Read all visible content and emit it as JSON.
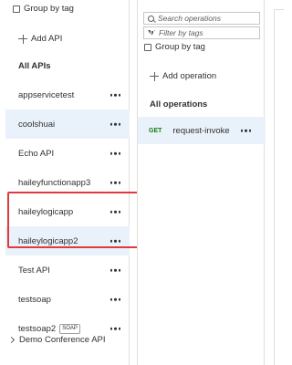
{
  "apis_panel": {
    "group_by_tag_label": "Group by tag",
    "add_api_label": "Add API",
    "section_title": "All APIs",
    "items": [
      {
        "label": "appservicetest"
      },
      {
        "label": "coolshuai"
      },
      {
        "label": "Echo API"
      },
      {
        "label": "haileyfunctionapp3"
      },
      {
        "label": "haileylogicapp"
      },
      {
        "label": "haileylogicapp2"
      },
      {
        "label": "Test API"
      },
      {
        "label": "testsoap"
      },
      {
        "label": "testsoap2",
        "badge": "SOAP"
      }
    ],
    "tree_item_label": "Demo Conference API"
  },
  "operations_panel": {
    "search_placeholder": "Search operations",
    "filter_placeholder": "Filter by tags",
    "group_by_tag_label": "Group by tag",
    "add_operation_label": "Add operation",
    "section_title": "All operations",
    "operations": [
      {
        "method": "GET",
        "name": "request-invoke"
      }
    ]
  },
  "colors": {
    "selected_bg": "#e9f2fb",
    "highlight_border": "#e03a3a",
    "get_method": "#107c10"
  }
}
